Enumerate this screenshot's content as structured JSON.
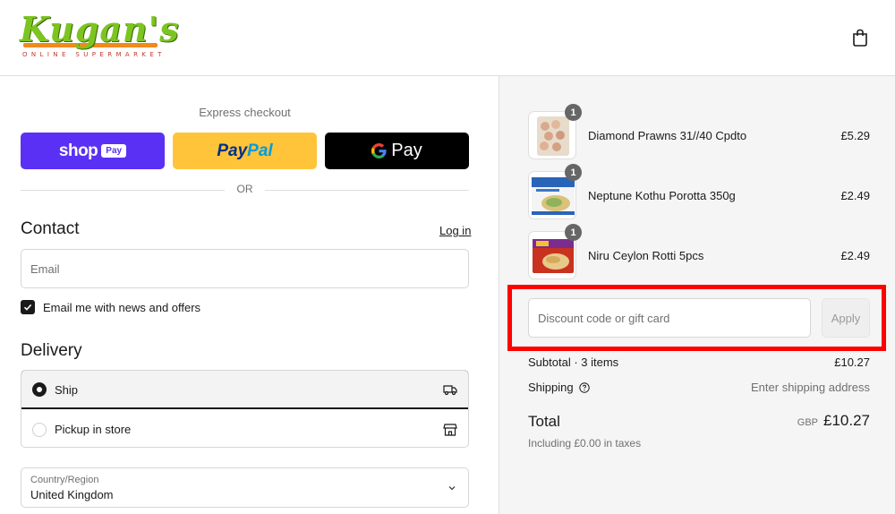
{
  "brand": {
    "name": "Kugan's",
    "tagline": "ONLINE SUPERMARKET"
  },
  "express": {
    "title": "Express checkout",
    "shop_word": "shop",
    "shop_badge": "Pay",
    "paypal_a": "Pay",
    "paypal_b": "Pal",
    "gpay_word": "Pay",
    "or": "OR"
  },
  "contact": {
    "title": "Contact",
    "login": "Log in",
    "email_placeholder": "Email",
    "newsletter_label": "Email me with news and offers",
    "newsletter_checked": true
  },
  "delivery": {
    "title": "Delivery",
    "options": [
      {
        "label": "Ship",
        "selected": true,
        "icon": "truck-icon"
      },
      {
        "label": "Pickup in store",
        "selected": false,
        "icon": "store-icon"
      }
    ],
    "country_label": "Country/Region",
    "country_value": "United Kingdom"
  },
  "cart": {
    "items": [
      {
        "qty": "1",
        "name": "Diamond Prawns 31//40 Cpdto",
        "price": "£5.29"
      },
      {
        "qty": "1",
        "name": "Neptune Kothu Porotta 350g",
        "price": "£2.49"
      },
      {
        "qty": "1",
        "name": "Niru Ceylon Rotti 5pcs",
        "price": "£2.49"
      }
    ],
    "discount_placeholder": "Discount code or gift card",
    "apply": "Apply",
    "subtotal_label": "Subtotal · 3 items",
    "subtotal_value": "£10.27",
    "shipping_label": "Shipping",
    "shipping_value": "Enter shipping address",
    "total_label": "Total",
    "currency": "GBP",
    "total_value": "£10.27",
    "tax_note": "Including £0.00 in taxes"
  },
  "colors": {
    "shop_pay": "#5a31f4",
    "paypal": "#ffc439",
    "gpay": "#000000",
    "highlight": "#ff0000"
  }
}
